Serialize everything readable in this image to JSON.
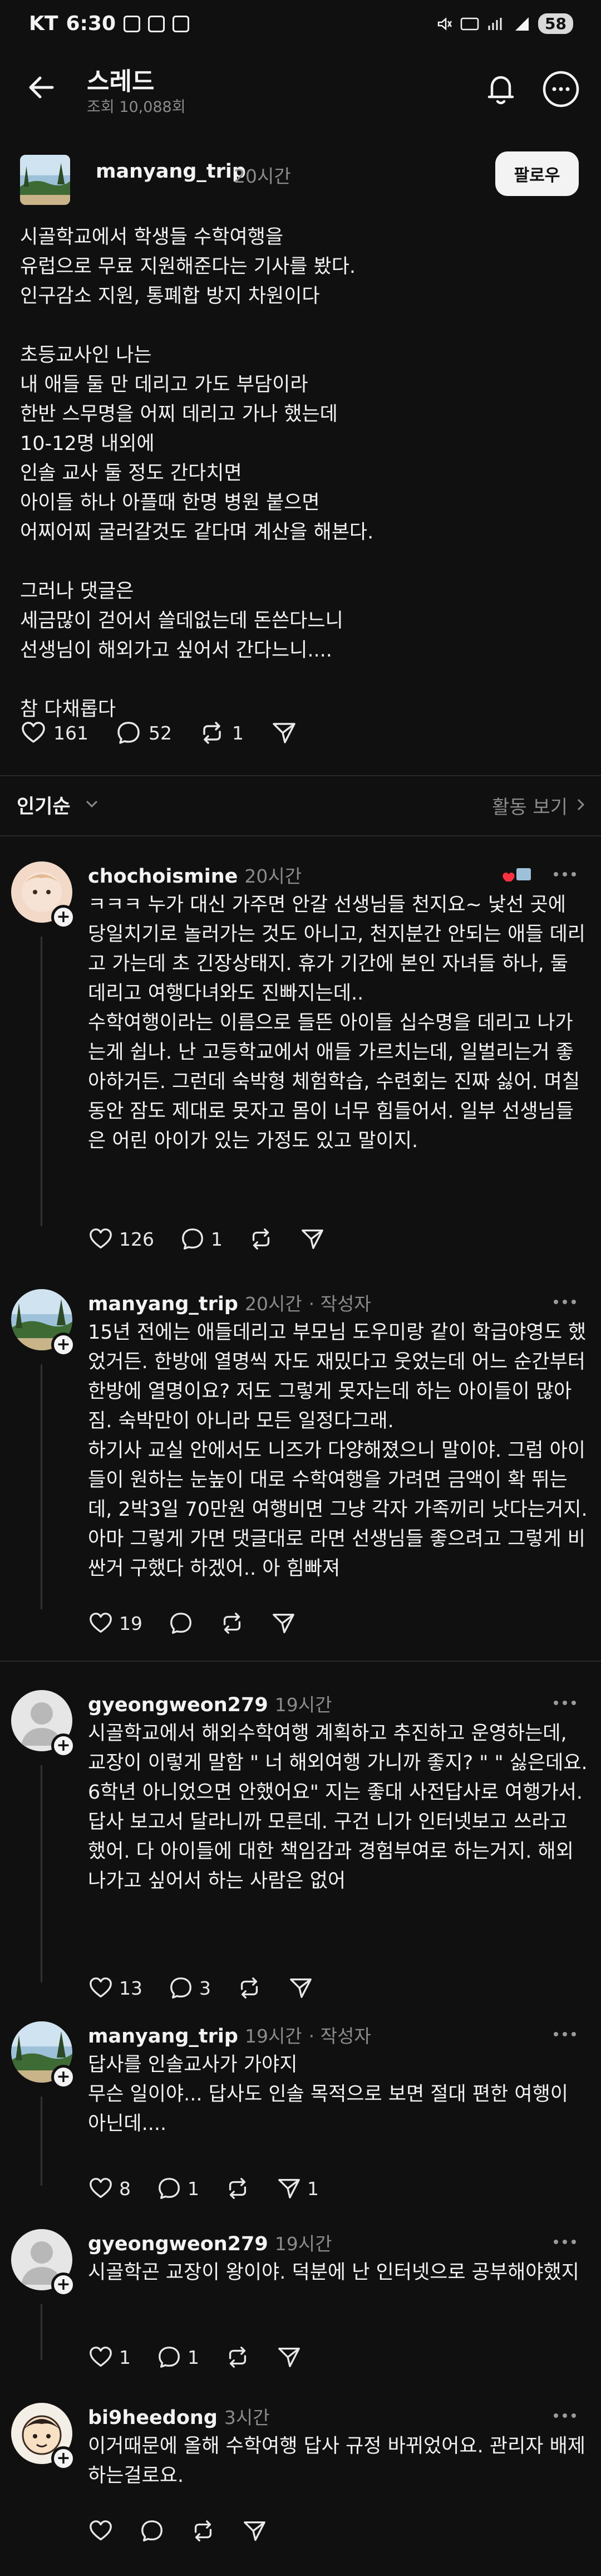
{
  "status_bar": {
    "carrier": "KT",
    "time": "6:30",
    "battery": "58"
  },
  "header": {
    "title": "스레드",
    "views": "조회 10,088회"
  },
  "post": {
    "username": "manyang_trip",
    "time": "20시간",
    "follow_label": "팔로우",
    "body": "시골학교에서 학생들 수학여행을\n유럽으로 무료 지원해준다는 기사를 봤다.\n인구감소 지원, 통폐합 방지 차원이다\n\n초등교사인 나는\n내 애들 둘 만 데리고 가도 부담이라\n한반 스무명을 어찌 데리고 가나 했는데\n10-12명 내외에\n인솔 교사 둘 정도 간다치면\n아이들 하나 아플때 한명 병원 붙으면\n어찌어찌 굴러갈것도 같다며 계산을 해본다.\n\n그러나 댓글은\n세금많이 걷어서 쓸데없는데 돈쓴다느니\n선생님이 해외가고 싶어서 간다느니....\n\n참 다채롭다",
    "likes": "161",
    "replies": "52",
    "reposts": "1"
  },
  "sort": {
    "label": "인기순",
    "activity_label": "활동 보기"
  },
  "comments": [
    {
      "username": "chochoismine",
      "time": "20시간",
      "author_tag": "",
      "body": "ㅋㅋㅋ 누가 대신 가주면 안갈 선생님들 천지요~ 낯선 곳에 당일치기로 놀러가는 것도 아니고, 천지분간 안되는 애들 데리고 가는데 초 긴장상태지. 휴가 기간에 본인 자녀들 하나, 둘 데리고 여행다녀와도 진빠지는데..\n수학여행이라는 이름으로 들뜬 아이들 십수명을 데리고 나가는게 쉽나. 난 고등학교에서 애들 가르치는데, 일벌리는거 좋아하거든. 그런데 숙박형 체험학습, 수련회는 진짜 싫어. 며칠동안 잠도 제대로 못자고 몸이 너무 힘들어서. 일부 선생님들은 어린 아이가 있는 가정도 있고 말이지.",
      "likes": "126",
      "replies": "1",
      "reposts": ""
    },
    {
      "username": "manyang_trip",
      "time": "20시간",
      "author_tag": "· 작성자",
      "body": "15년 전에는 애들데리고 부모님 도우미랑 같이 학급야영도 했었거든. 한방에 열명씩 자도 재밌다고 웃었는데 어느 순간부터 한방에 열명이요? 저도 그렇게 못자는데 하는 아이들이 많아짐. 숙박만이 아니라 모든 일정다그래.\n하기사 교실 안에서도 니즈가 다양해졌으니 말이야. 그럼 아이들이 원하는 눈높이 대로 수학여행을 가려면 금액이 확 뛰는데, 2박3일 70만원 여행비면 그냥 각자 가족끼리 낫다는거지. 아마 그렇게 가면 댓글대로 라면 선생님들 좋으려고 그렇게 비싼거 구했다 하겠어.. 아 힘빠져",
      "likes": "19",
      "replies": "",
      "reposts": ""
    },
    {
      "username": "gyeongweon279",
      "time": "19시간",
      "author_tag": "",
      "body": "시골학교에서 해외수학여행 계획하고 추진하고 운영하는데, 교장이 이렇게 말함 \" 너 해외여행 가니까 좋지? \" \" 싫은데요. 6학년 아니었으면 안했어요\" 지는 좋대 사전답사로 여행가서. 답사 보고서 달라니까 모른데. 구건 니가 인터넷보고 쓰라고 했어. 다 아이들에 대한 책임감과 경험부여로 하는거지. 해외 나가고 싶어서 하는 사람은 없어",
      "likes": "13",
      "replies": "3",
      "reposts": ""
    },
    {
      "username": "manyang_trip",
      "time": "19시간",
      "author_tag": "· 작성자",
      "body": "답사를 인솔교사가 가야지\n무슨 일이야... 답사도 인솔 목적으로 보면 절대 편한 여행이 아닌데....",
      "likes": "8",
      "replies": "1",
      "reposts": "",
      "shares": "1"
    },
    {
      "username": "gyeongweon279",
      "time": "19시간",
      "author_tag": "",
      "body": "시골학곤 교장이 왕이야. 덕분에 난 인터넷으로 공부해야했지",
      "likes": "1",
      "replies": "1",
      "reposts": ""
    },
    {
      "username": "bi9heedong",
      "time": "3시간",
      "author_tag": "",
      "body": "이거때문에 올해 수학여행 답사 규정 바뀌었어요. 관리자 배제하는걸로요.",
      "likes": "",
      "replies": "",
      "reposts": ""
    }
  ],
  "colors": {
    "background": "#101010",
    "text": "#f3f3f3",
    "muted": "#8b8b8b",
    "divider": "#2a2a2a"
  },
  "icons": [
    "back-arrow-icon",
    "bell-icon",
    "more-icon",
    "heart-icon",
    "reply-bubble-icon",
    "repost-icon",
    "share-plane-icon",
    "chevron-down-icon",
    "chevron-right-icon"
  ]
}
